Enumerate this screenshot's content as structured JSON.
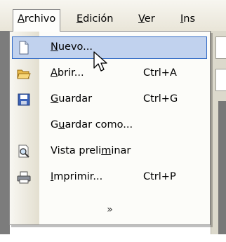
{
  "menubar": {
    "items": [
      {
        "label": "Archivo"
      },
      {
        "label": "Edición"
      },
      {
        "label": "Ver"
      },
      {
        "label": "Ins"
      }
    ]
  },
  "menu": {
    "items": [
      {
        "label": "Nuevo...",
        "shortcut": "",
        "icon": "new-document-icon"
      },
      {
        "label": "Abrir...",
        "shortcut": "Ctrl+A",
        "icon": "open-folder-icon"
      },
      {
        "label": "Guardar",
        "shortcut": "Ctrl+G",
        "icon": "save-disk-icon"
      },
      {
        "label": "Guardar como...",
        "shortcut": "",
        "icon": ""
      },
      {
        "label": "Vista preliminar",
        "shortcut": "",
        "icon": "print-preview-icon"
      },
      {
        "label": "Imprimir...",
        "shortcut": "Ctrl+P",
        "icon": "printer-icon"
      }
    ],
    "expand_glyph": "»",
    "highlighted_index": 0
  },
  "colors": {
    "highlight_fill": "#c1d2ee",
    "highlight_border": "#316ac5"
  }
}
